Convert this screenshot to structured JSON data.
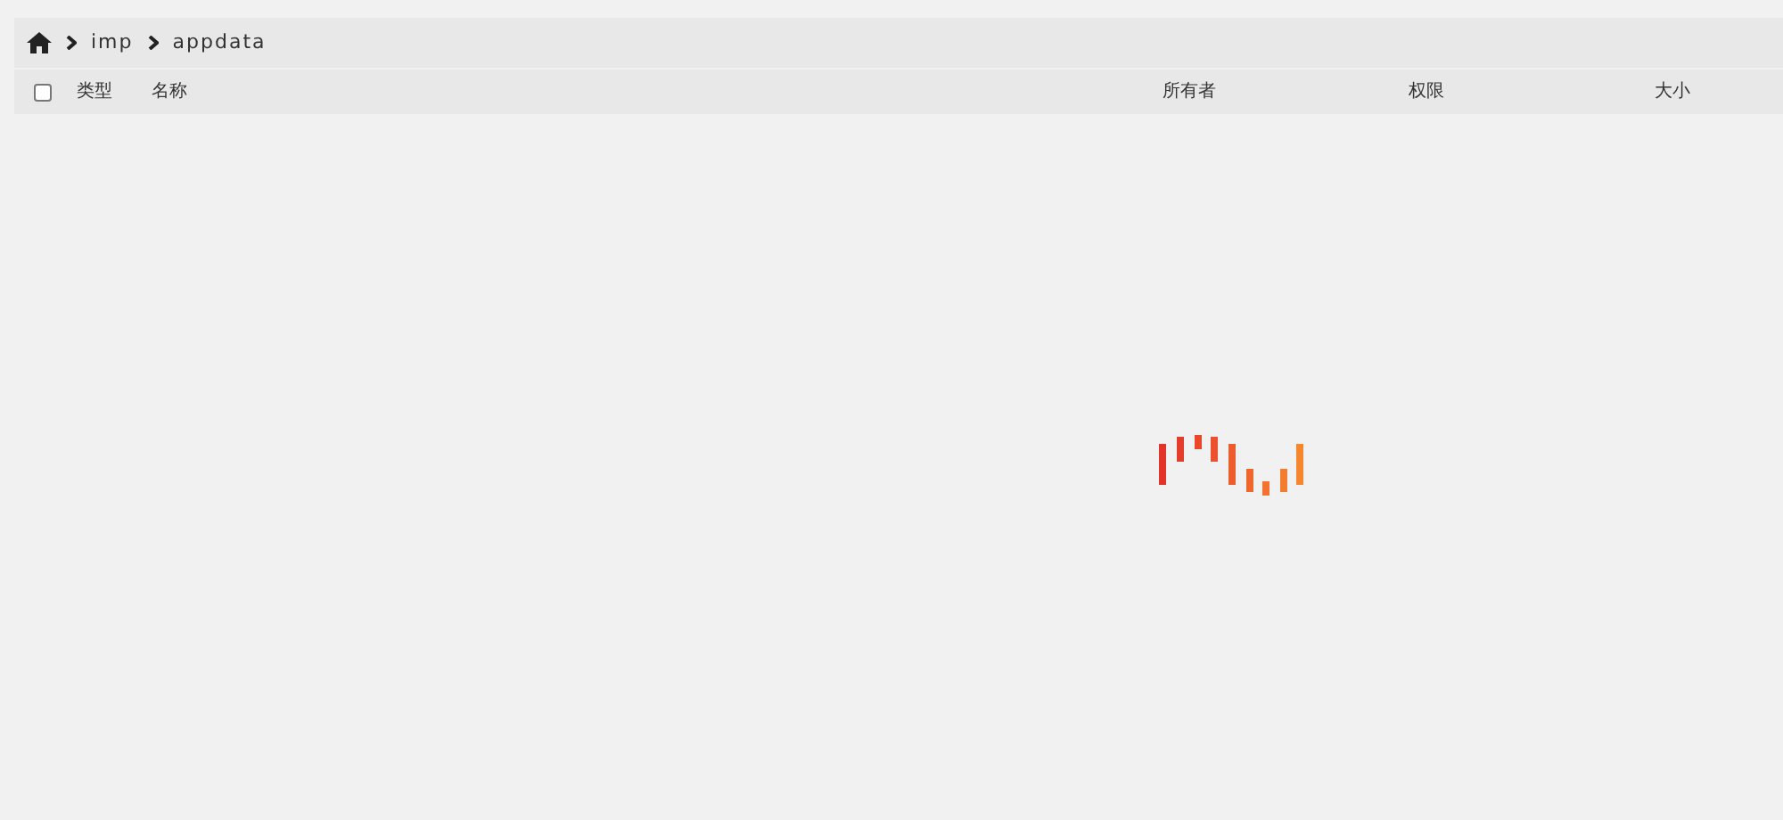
{
  "breadcrumb": [
    {
      "label": "imp"
    },
    {
      "label": "appdata"
    }
  ],
  "table": {
    "select_all": {
      "checked": false
    },
    "columns": [
      "类型",
      "名称",
      "所有者",
      "权限",
      "大小"
    ]
  }
}
